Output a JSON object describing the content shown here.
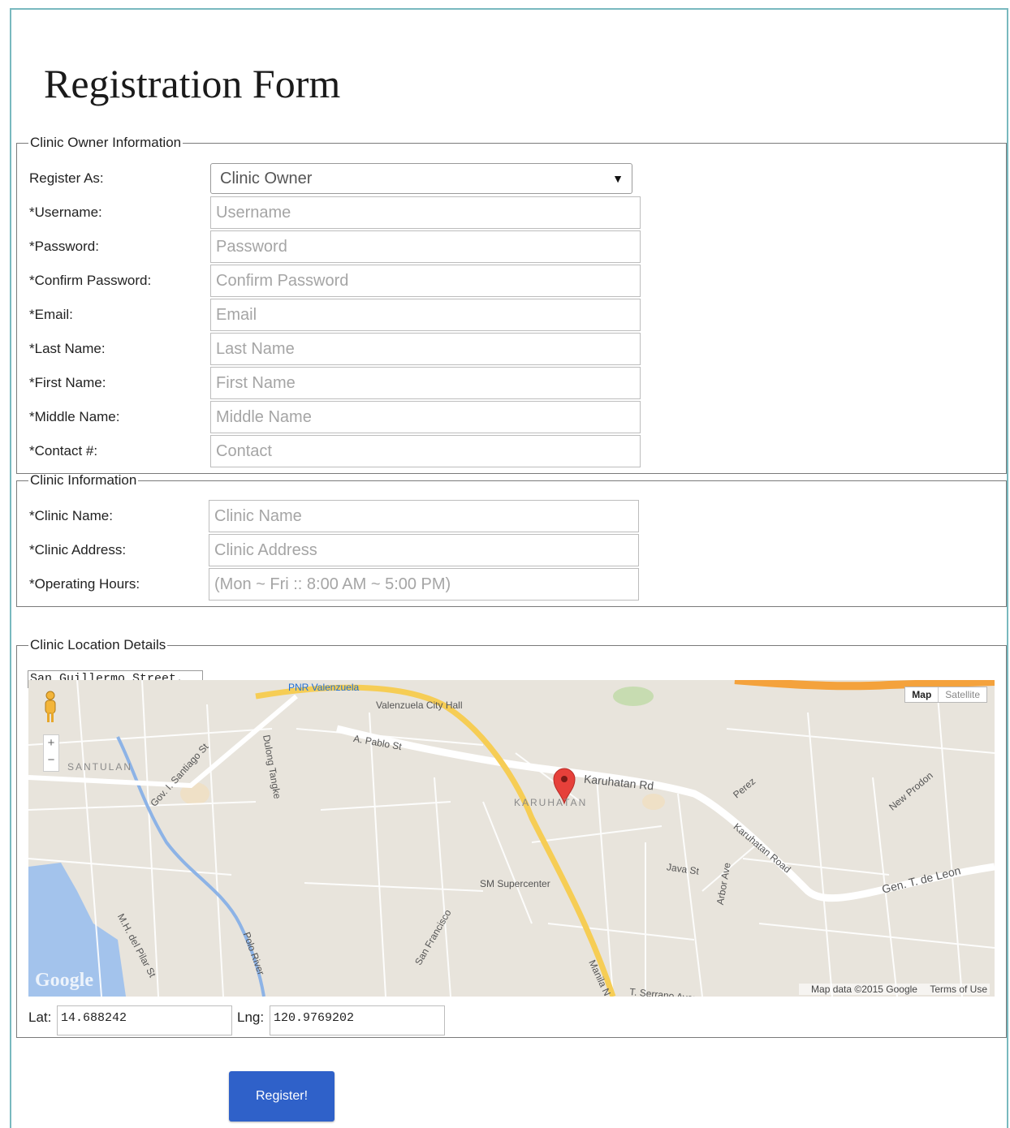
{
  "form": {
    "title": "Registration Form",
    "submit_label": "Register!"
  },
  "owner_section": {
    "legend": "Clinic Owner Information",
    "register_as": {
      "label": "Register As:",
      "selected": "Clinic Owner"
    },
    "fields": [
      {
        "label": "*Username:",
        "placeholder": "Username"
      },
      {
        "label": "*Password:",
        "placeholder": "Password"
      },
      {
        "label": "*Confirm Password:",
        "placeholder": "Confirm Password"
      },
      {
        "label": "*Email:",
        "placeholder": "Email"
      },
      {
        "label": "*Last Name:",
        "placeholder": "Last Name"
      },
      {
        "label": "*First Name:",
        "placeholder": "First Name"
      },
      {
        "label": "*Middle Name:",
        "placeholder": "Middle Name"
      },
      {
        "label": "*Contact #:",
        "placeholder": "Contact"
      }
    ]
  },
  "clinic_section": {
    "legend": "Clinic Information",
    "fields": [
      {
        "label": "*Clinic Name:",
        "placeholder": "Clinic Name"
      },
      {
        "label": "*Clinic Address:",
        "placeholder": "Clinic Address"
      },
      {
        "label": "*Operating Hours:",
        "placeholder": "(Mon ~ Fri :: 8:00 AM ~ 5:00 PM)"
      }
    ]
  },
  "location_section": {
    "legend": "Clinic Location Details",
    "address_value": "San Guillermo Street, Ciud",
    "map": {
      "map_type_active": "Map",
      "map_type_inactive": "Satellite",
      "attribution": "Map data ©2015 Google",
      "terms": "Terms of Use",
      "logo": "Google",
      "labels": [
        "PNR Valenzuela",
        "Valenzuela City Hall",
        "A. Pablo St",
        "Karuhatan Rd",
        "KARUHATAN",
        "SANTULAN",
        "SM Supercenter",
        "Gen. T. de Leon",
        "Karuhatan Road",
        "Polo River",
        "Manila N",
        "Java St",
        "Arbor Ave",
        "Perez",
        "New Prodon",
        "T. Serrano Avenue",
        "San Francisco",
        "Gov. I. Santiago St",
        "M.H. del Pilar St",
        "Dulong Tangke"
      ]
    },
    "lat_label": "Lat:",
    "lat_value": "14.688242",
    "lng_label": "Lng:",
    "lng_value": "120.9769202"
  }
}
